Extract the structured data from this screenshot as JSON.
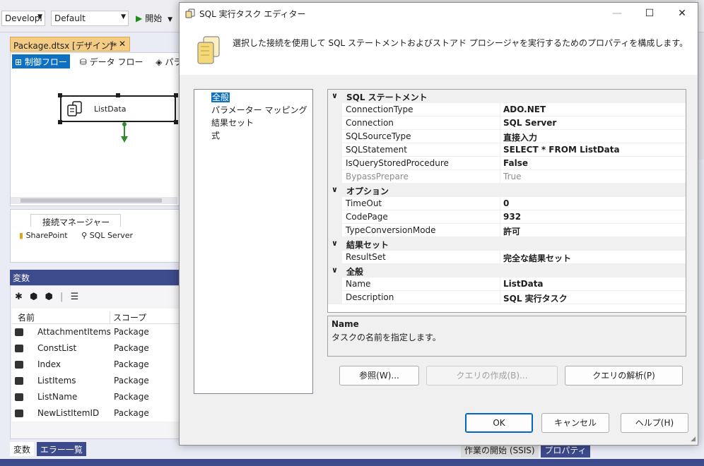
{
  "ide": {
    "config_combo": "Developi",
    "platform_combo": "Default",
    "start_label": "開始",
    "doc_tab_title": "Package.dtsx [デザイン]*",
    "designer_tabs": [
      "制御フロー",
      "データ フロー",
      "パラメー"
    ],
    "task_name": "ListData",
    "conn_tab_label": "接続マネージャー",
    "connections": [
      "SharePoint",
      "SQL Server"
    ],
    "variables_title": "変数",
    "var_headers": {
      "name": "名前",
      "scope": "スコープ"
    },
    "variables": [
      {
        "name": "AttachmentItems",
        "scope": "Package"
      },
      {
        "name": "ConstList",
        "scope": "Package"
      },
      {
        "name": "Index",
        "scope": "Package"
      },
      {
        "name": "ListItems",
        "scope": "Package"
      },
      {
        "name": "ListName",
        "scope": "Package"
      },
      {
        "name": "NewListItemID",
        "scope": "Package"
      }
    ],
    "bottom_tabs": [
      "変数",
      "エラー一覧"
    ],
    "bottom_right_tabs": [
      "作業の開始 (SSIS)",
      "プロパティ"
    ]
  },
  "dialog": {
    "title": "SQL 実行タスク エディター",
    "header_text": "選択した接続を使用して SQL ステートメントおよびストアド プロシージャを実行するためのプロパティを構成します。",
    "nav_items": [
      "全般",
      "パラメーター マッピング",
      "結果セット",
      "式"
    ],
    "selected_nav": "全般",
    "categories": [
      {
        "name": "SQL ステートメント",
        "rows": [
          {
            "name": "ConnectionType",
            "value": "ADO.NET",
            "disabled": false
          },
          {
            "name": "Connection",
            "value": "SQL Server",
            "disabled": false
          },
          {
            "name": "SQLSourceType",
            "value": "直接入力",
            "disabled": false
          },
          {
            "name": "SQLStatement",
            "value": "SELECT * FROM ListData",
            "disabled": false
          },
          {
            "name": "IsQueryStoredProcedure",
            "value": "False",
            "disabled": false
          },
          {
            "name": "BypassPrepare",
            "value": "True",
            "disabled": true
          }
        ]
      },
      {
        "name": "オプション",
        "rows": [
          {
            "name": "TimeOut",
            "value": "0",
            "disabled": false
          },
          {
            "name": "CodePage",
            "value": "932",
            "disabled": false
          },
          {
            "name": "TypeConversionMode",
            "value": "許可",
            "disabled": false
          }
        ]
      },
      {
        "name": "結果セット",
        "rows": [
          {
            "name": "ResultSet",
            "value": "完全な結果セット",
            "disabled": false
          }
        ]
      },
      {
        "name": "全般",
        "rows": [
          {
            "name": "Name",
            "value": "ListData",
            "disabled": false
          },
          {
            "name": "Description",
            "value": "SQL 実行タスク",
            "disabled": false
          }
        ]
      }
    ],
    "description_title": "Name",
    "description_text": "タスクの名前を指定します。",
    "buttons": {
      "browse": "参照(W)...",
      "build_query": "クエリの作成(B)...",
      "parse_query": "クエリの解析(P)",
      "ok": "OK",
      "cancel": "キャンセル",
      "help": "ヘルプ(H)"
    }
  }
}
